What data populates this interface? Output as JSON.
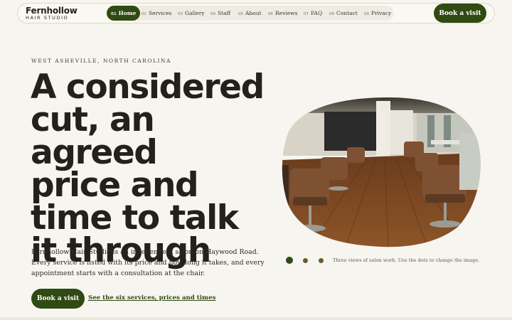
{
  "brand": {
    "name": "Fernhollow",
    "subtitle": "HAIR STUDIO"
  },
  "nav": {
    "items": [
      {
        "num": "01",
        "label": "Home",
        "active": true
      },
      {
        "num": "02",
        "label": "Services"
      },
      {
        "num": "03",
        "label": "Gallery"
      },
      {
        "num": "04",
        "label": "Staff"
      },
      {
        "num": "05",
        "label": "About"
      },
      {
        "num": "06",
        "label": "Reviews"
      },
      {
        "num": "07",
        "label": "FAQ"
      },
      {
        "num": "08",
        "label": "Contact"
      },
      {
        "num": "09",
        "label": "Privacy"
      }
    ],
    "cta": "Book a visit"
  },
  "hero": {
    "eyebrow": "WEST ASHEVILLE, NORTH CAROLINA",
    "headline_lines": [
      "A considered",
      "cut, an agreed",
      "price and",
      "time to talk",
      "it through"
    ],
    "intro": "Fernhollow Hair Studio is an independent salon on Haywood Road. Every service is listed with its price and how long it takes, and every appointment starts with a consultation at the chair.",
    "cta": "Book a visit",
    "link": "See the six services, prices and times"
  },
  "gallery": {
    "caption": "Three views of salon work. Use the dots to change the image.",
    "active_dot": 1,
    "dot_count": 3
  },
  "colors": {
    "accent": "#2f4a12",
    "background": "#f7f5ef",
    "text": "#23211a",
    "dot_inactive": "#6b5a36"
  }
}
